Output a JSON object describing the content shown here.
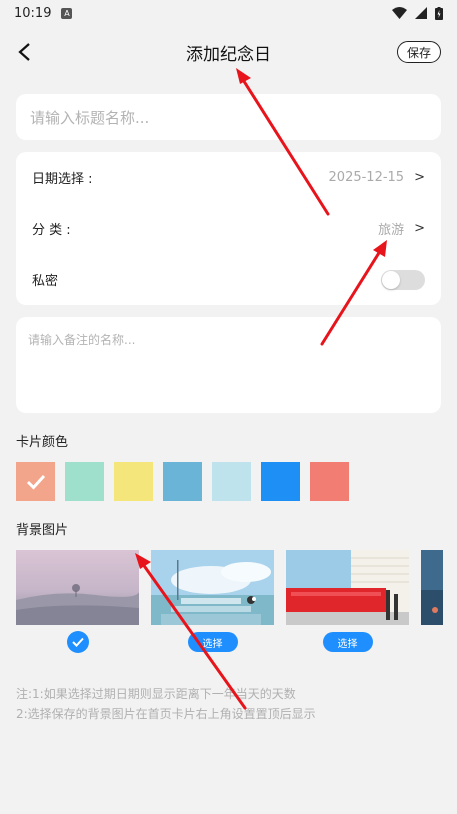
{
  "status": {
    "time": "10:19",
    "notif": "A"
  },
  "nav": {
    "title": "添加纪念日",
    "save_label": "保存"
  },
  "title_input": {
    "placeholder": "请输入标题名称..."
  },
  "settings": {
    "date_label": "日期选择 :",
    "date_value": "2025-12-15",
    "category_label": "分 类 :",
    "category_value": "旅游",
    "private_label": "私密",
    "private_on": false,
    "chevron": ">"
  },
  "note": {
    "placeholder": "请输入备注的名称..."
  },
  "card_color": {
    "label": "卡片颜色",
    "colors": [
      "#f2a58a",
      "#9ee0cc",
      "#f4e67a",
      "#6ab4d8",
      "#bfe3ec",
      "#1e8ff5",
      "#f27e73"
    ],
    "selected_index": 0
  },
  "background": {
    "label": "背景图片",
    "select_label": "选择",
    "selected_index": 0
  },
  "footnote": {
    "line1": "注:1:如果选择过期日期则显示距离下一年当天的天数",
    "line2": "2:选择保存的背景图片在首页卡片右上角设置置顶后显示"
  },
  "colors": {
    "accent": "#1f8fff",
    "annotation": "#e8141c"
  }
}
